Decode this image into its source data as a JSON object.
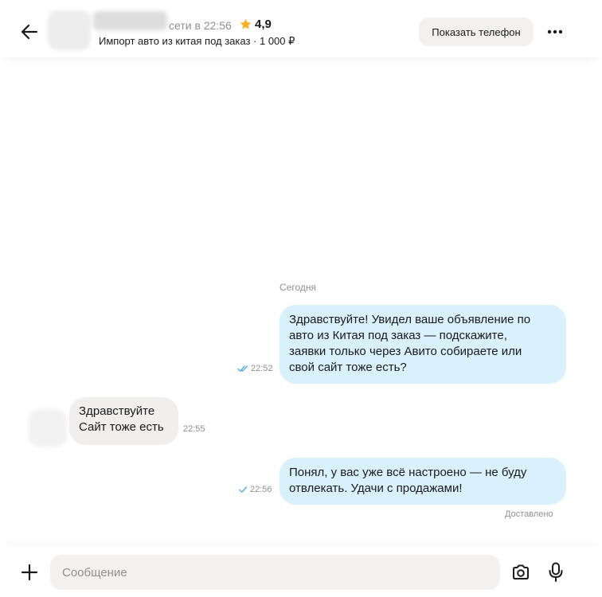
{
  "header": {
    "online_status": "сети в 22:56",
    "rating": "4,9",
    "subtitle": "Импорт авто из китая под заказ · 1 000 ₽",
    "show_phone_label": "Показать телефон"
  },
  "chat": {
    "date_separator": "Сегодня",
    "messages": [
      {
        "direction": "outgoing",
        "lines": [
          "Здравствуйте! Увидел ваше объявление по",
          "авто из Китая под заказ — подскажите,",
          "заявки только через Авито собираете или",
          "свой сайт тоже есть?"
        ],
        "time": "22:52",
        "status": "read"
      },
      {
        "direction": "incoming",
        "lines": [
          "Здравствуйте",
          "Сайт тоже есть"
        ],
        "time": "22:55"
      },
      {
        "direction": "outgoing",
        "lines": [
          "Понял, у вас уже всё настроено — не буду",
          "отвлекать. Удачи с продажами!"
        ],
        "time": "22:56",
        "status": "sent"
      }
    ],
    "delivered_label": "Доставлено"
  },
  "composer": {
    "placeholder": "Сообщение"
  },
  "colors": {
    "outgoing_bubble": "#d9f0fd",
    "incoming_bubble": "#f0efee",
    "check_blue": "#3fa9e8",
    "star": "#ffb021"
  },
  "icons": [
    "back-arrow-icon",
    "star-icon",
    "more-icon",
    "double-check-icon",
    "single-check-icon",
    "plus-icon",
    "camera-icon",
    "microphone-icon"
  ]
}
